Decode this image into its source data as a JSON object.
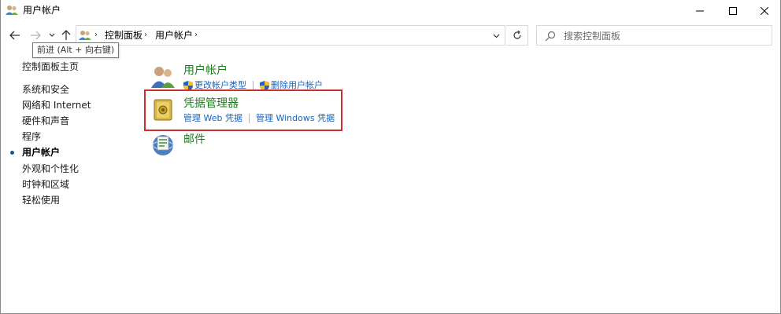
{
  "window": {
    "title": "用户帐户",
    "controls": [
      "minimize",
      "maximize",
      "close"
    ]
  },
  "nav": {
    "breadcrumbs": [
      "控制面板",
      "用户帐户"
    ],
    "search_placeholder": "搜索控制面板",
    "tooltip": "前进 (Alt + 向右键)"
  },
  "sidebar": {
    "items": [
      {
        "label": "控制面板主页",
        "active": false
      },
      {
        "label": "系统和安全",
        "active": false
      },
      {
        "label": "网络和 Internet",
        "active": false
      },
      {
        "label": "硬件和声音",
        "active": false
      },
      {
        "label": "程序",
        "active": false
      },
      {
        "label": "用户帐户",
        "active": true
      },
      {
        "label": "外观和个性化",
        "active": false
      },
      {
        "label": "时钟和区域",
        "active": false
      },
      {
        "label": "轻松使用",
        "active": false
      }
    ]
  },
  "categories": [
    {
      "title": "用户帐户",
      "icon": "users-icon",
      "links": [
        {
          "label": "更改帐户类型",
          "shield": true
        },
        {
          "label": "删除用户帐户",
          "shield": true
        }
      ]
    },
    {
      "title": "凭据管理器",
      "icon": "credential-vault-icon",
      "highlighted": true,
      "links": [
        {
          "label": "管理 Web 凭据",
          "shield": false
        },
        {
          "label": "管理 Windows 凭据",
          "shield": false
        }
      ]
    },
    {
      "title": "邮件",
      "icon": "mail-icon",
      "links": []
    }
  ],
  "colors": {
    "category_title": "#1e7a1e",
    "link": "#1565c0",
    "highlight_border": "#cc2f2f",
    "active_bullet": "#1f4e9c"
  }
}
